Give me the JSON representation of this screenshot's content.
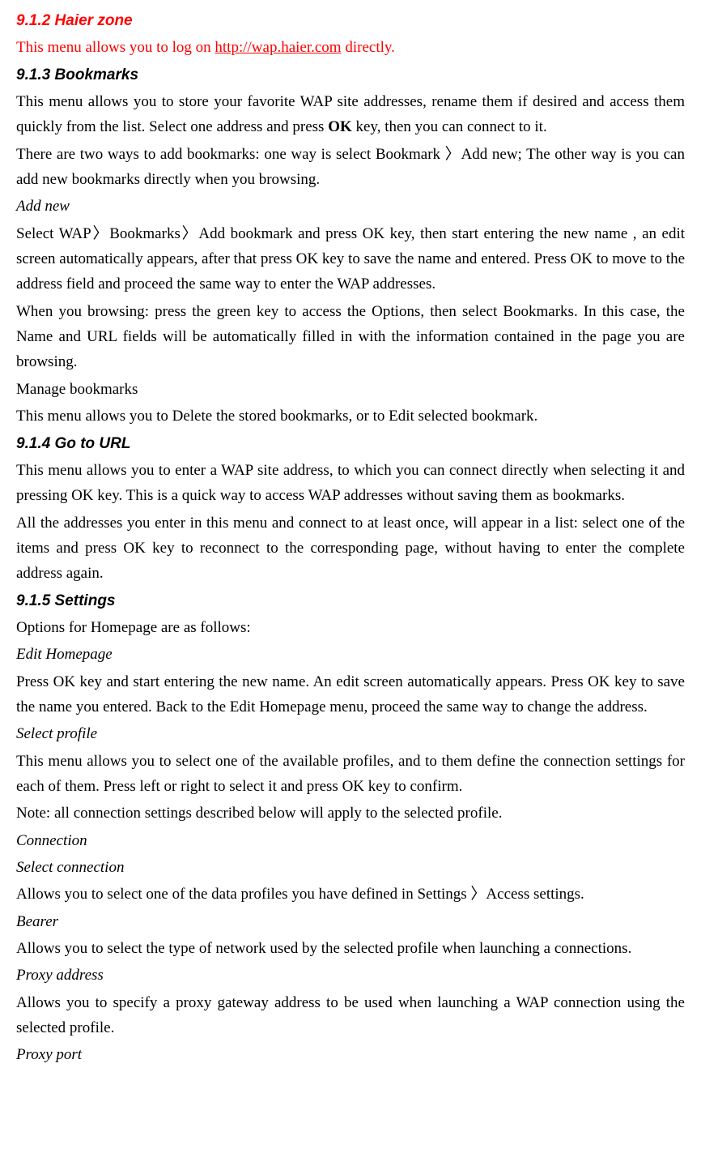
{
  "h_912": "9.1.2 Haier zone",
  "p_912_a": "This menu allows you to log on ",
  "p_912_link": "http://wap.haier.com",
  "p_912_b": " directly.",
  "h_913": "9.1.3 Bookmarks",
  "p_913_a": "This menu allows you to store your favorite WAP site addresses, rename them if desired and access them quickly from the list. Select one address and press ",
  "p_913_ok": "OK",
  "p_913_b": " key, then you can connect to it.",
  "p_913_c": "There are two ways to add bookmarks: one way is select Bookmark 〉Add new; The other way is you can add new bookmarks directly when you browsing.",
  "addnew_h": "Add new",
  "addnew_p1": "Select WAP〉Bookmarks〉Add bookmark and press OK key, then start entering the new name , an edit screen automatically appears, after that press OK key to save the name and entered. Press OK to move to the address field and proceed the same way to enter the WAP addresses.",
  "addnew_p2": "When you browsing: press the green key to access the Options, then select Bookmarks. In this case, the Name and URL fields will be automatically filled in with the information contained in the page you are browsing.",
  "manage_h": "Manage bookmarks",
  "manage_p": "This menu allows you to Delete the stored bookmarks, or to Edit selected bookmark.",
  "h_914": "9.1.4 Go to URL",
  "p_914_a": "This menu allows you to enter a WAP site address, to which you can connect directly when selecting it and pressing OK key. This is a quick way to access WAP addresses without saving them as bookmarks.",
  "p_914_b": "All the addresses you enter in this menu and connect to at least once, will appear in a list: select one of the items and press OK key to reconnect to the corresponding page, without having to enter the complete address again.",
  "h_915": "9.1.5 Settings",
  "p_915_a": "Options for Homepage are as follows:",
  "edithome_h": "Edit Homepage",
  "edithome_p": "Press OK key and start entering the new name. An edit screen automatically appears. Press OK key to save the name you entered. Back to the Edit Homepage menu, proceed the same way to change the address.",
  "profile_h": "Select profile",
  "profile_p1": "This menu allows you to select one of the available profiles, and to them define the connection settings for each of them. Press left or right to select it and press OK key to confirm.",
  "profile_p2": "Note: all connection settings described below will apply to the selected profile.",
  "conn_h": "Connection",
  "selconn_h": "Select connection",
  "selconn_p": "Allows you to select one of the data profiles you have defined in Settings 〉Access settings.",
  "bearer_h": "Bearer",
  "bearer_p": "Allows you to select the type of network used by the selected profile when launching a connections.",
  "proxyaddr_h": "Proxy address",
  "proxyaddr_p": "Allows you to specify a proxy gateway address to be used when launching a WAP connection using the selected profile.",
  "proxyport_h": "Proxy port"
}
